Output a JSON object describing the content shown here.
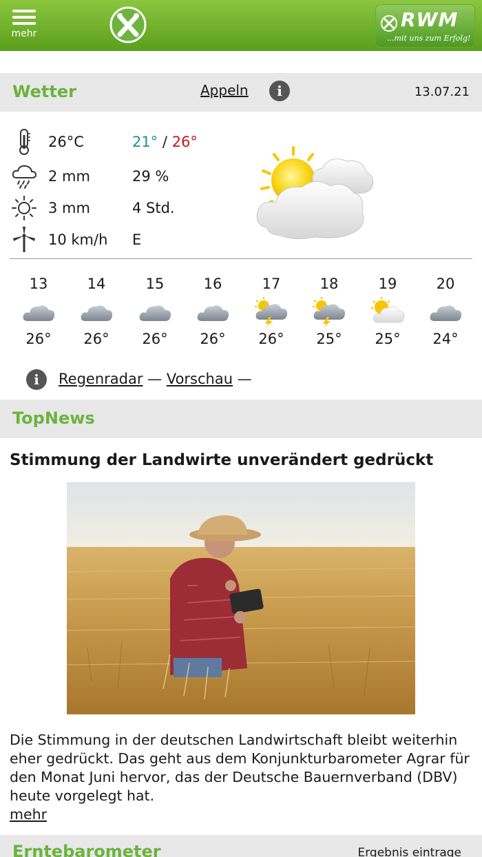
{
  "header": {
    "menu_label": "mehr",
    "brand_name": "RWM",
    "brand_slogan": "...mit uns zum Erfolg!",
    "accent_color": "#6cb33f"
  },
  "weather": {
    "section_title": "Wetter",
    "location": "Appeln",
    "date": "13.07.21",
    "current": {
      "temperature": "26°C",
      "temp_min": "21°",
      "temp_separator": "/",
      "temp_max": "26°",
      "precipitation": "2 mm",
      "precip_probability": "29 %",
      "sunshine_value": "3 mm",
      "sunshine_hours": "4 Std.",
      "wind_speed": "10 km/h",
      "wind_direction": "E",
      "icons": [
        "thermometer-icon",
        "rain-cloud-icon",
        "sun-icon",
        "wind-turbine-icon"
      ],
      "condition_icon": "sun-behind-clouds-icon"
    },
    "forecast": [
      {
        "day": "13",
        "temp": "26°",
        "icon": "cloud"
      },
      {
        "day": "14",
        "temp": "26°",
        "icon": "cloud"
      },
      {
        "day": "15",
        "temp": "26°",
        "icon": "cloud"
      },
      {
        "day": "16",
        "temp": "26°",
        "icon": "cloud"
      },
      {
        "day": "17",
        "temp": "26°",
        "icon": "thunderstorm"
      },
      {
        "day": "18",
        "temp": "25°",
        "icon": "thunderstorm"
      },
      {
        "day": "19",
        "temp": "25°",
        "icon": "partly-sunny"
      },
      {
        "day": "20",
        "temp": "24°",
        "icon": "cloud"
      }
    ],
    "links": {
      "radar": "Regenradar",
      "dash1": "—",
      "preview": "Vorschau",
      "dash2": "—"
    }
  },
  "topnews": {
    "section_title": "TopNews",
    "headline": "Stimmung der Landwirte unverändert gedrückt",
    "body": "Die Stimmung in der deutschen Landwirtschaft bleibt weiterhin eher gedrückt. Das geht aus dem Konjunkturbarometer Agrar für den Monat Juni hervor, das der Deutsche Bauernverband (DBV) heute vorgelegt hat.",
    "more_label": "mehr"
  },
  "erntebarometer": {
    "section_title": "Erntebarometer",
    "action_label": "Ergebnis eintrage"
  }
}
